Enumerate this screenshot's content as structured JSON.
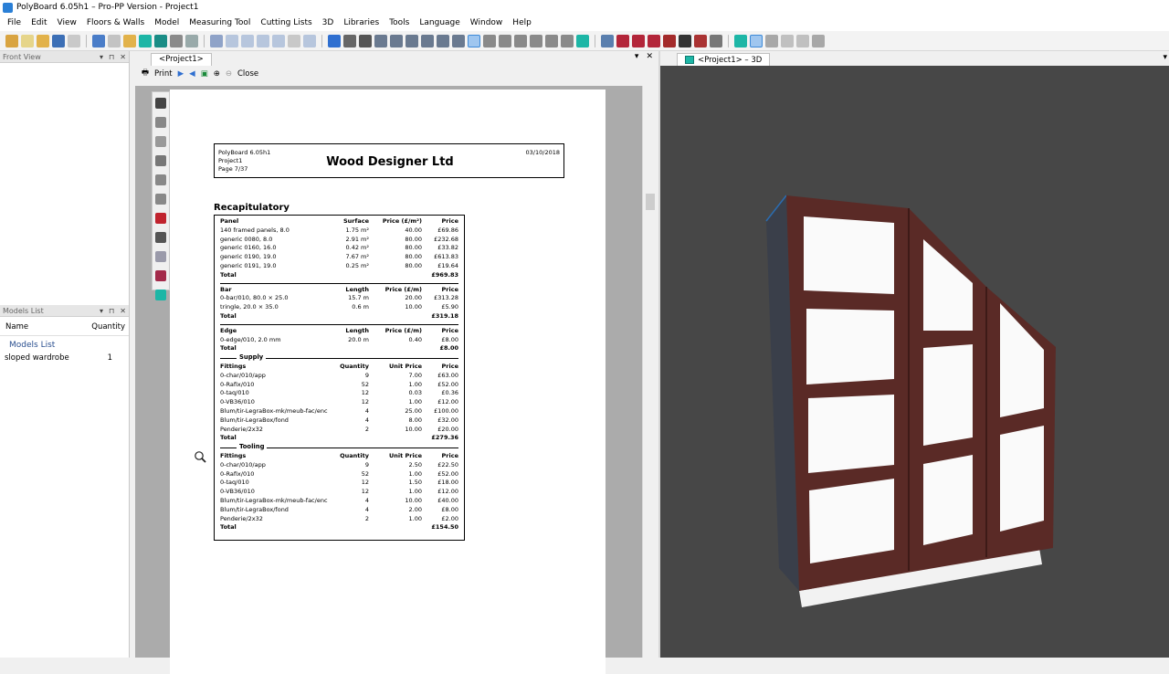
{
  "window": {
    "title": "PolyBoard 6.05h1 – Pro-PP Version - Project1"
  },
  "menu": [
    "File",
    "Edit",
    "View",
    "Floors & Walls",
    "Model",
    "Measuring Tool",
    "Cutting Lists",
    "3D",
    "Libraries",
    "Tools",
    "Language",
    "Window",
    "Help"
  ],
  "left_panel": {
    "front_view": {
      "title": "Front View"
    },
    "models_list": {
      "title": "Models List",
      "col_name": "Name",
      "col_quantity": "Quantity",
      "group": "Models List",
      "items": [
        {
          "name": "sloped wardrobe",
          "quantity": "1"
        }
      ]
    }
  },
  "doc_tab": {
    "label": "<Project1>"
  },
  "doc_toolbar": {
    "print": "Print",
    "close": "Close"
  },
  "report": {
    "meta": [
      "PolyBoard 6.05h1",
      "Project1",
      "Page 7/37"
    ],
    "company": "Wood Designer Ltd",
    "date": "03/10/2018",
    "section_title": "Recapitulatory",
    "panel": {
      "headers": [
        "Panel",
        "Surface",
        "Price (£/m²)",
        "Price"
      ],
      "rows": [
        [
          "140 framed panels, 8.0",
          "1.75 m²",
          "40.00",
          "£69.86"
        ],
        [
          "generic 0080, 8.0",
          "2.91 m²",
          "80.00",
          "£232.68"
        ],
        [
          "generic 0160, 16.0",
          "0.42 m²",
          "80.00",
          "£33.82"
        ],
        [
          "generic 0190, 19.0",
          "7.67 m²",
          "80.00",
          "£613.83"
        ],
        [
          "generic 0191, 19.0",
          "0.25 m²",
          "80.00",
          "£19.64"
        ]
      ],
      "total_label": "Total",
      "total": "£969.83"
    },
    "bar": {
      "headers": [
        "Bar",
        "Length",
        "Price (£/m)",
        "Price"
      ],
      "rows": [
        [
          "0-bar/010, 80.0 × 25.0",
          "15.7 m",
          "20.00",
          "£313.28"
        ],
        [
          "tringle, 20.0 × 35.0",
          "0.6 m",
          "10.00",
          "£5.90"
        ]
      ],
      "total_label": "Total",
      "total": "£319.18"
    },
    "edge": {
      "headers": [
        "Edge",
        "Length",
        "Price (£/m)",
        "Price"
      ],
      "rows": [
        [
          "0-edge/010, 2.0 mm",
          "20.0 m",
          "0.40",
          "£8.00"
        ]
      ],
      "total_label": "Total",
      "total": "£8.00"
    },
    "supply": {
      "title": "Supply",
      "headers": [
        "Fittings",
        "Quantity",
        "Unit Price",
        "Price"
      ],
      "rows": [
        [
          "0-char/010/app",
          "9",
          "7.00",
          "£63.00"
        ],
        [
          "0-Rafix/010",
          "52",
          "1.00",
          "£52.00"
        ],
        [
          "0-taq/010",
          "12",
          "0.03",
          "£0.36"
        ],
        [
          "0-VB36/010",
          "12",
          "1.00",
          "£12.00"
        ],
        [
          "Blum/tir-LegraBox-mk/meub-fac/enc",
          "4",
          "25.00",
          "£100.00"
        ],
        [
          "Blum/tir-LegraBox/fond",
          "4",
          "8.00",
          "£32.00"
        ],
        [
          "Penderie/2x32",
          "2",
          "10.00",
          "£20.00"
        ]
      ],
      "total_label": "Total",
      "total": "£279.36"
    },
    "tooling": {
      "title": "Tooling",
      "headers": [
        "Fittings",
        "Quantity",
        "Unit Price",
        "Price"
      ],
      "rows": [
        [
          "0-char/010/app",
          "9",
          "2.50",
          "£22.50"
        ],
        [
          "0-Rafix/010",
          "52",
          "1.00",
          "£52.00"
        ],
        [
          "0-taq/010",
          "12",
          "1.50",
          "£18.00"
        ],
        [
          "0-VB36/010",
          "12",
          "1.00",
          "£12.00"
        ],
        [
          "Blum/tir-LegraBox-mk/meub-fac/enc",
          "4",
          "10.00",
          "£40.00"
        ],
        [
          "Blum/tir-LegraBox/fond",
          "4",
          "2.00",
          "£8.00"
        ],
        [
          "Penderie/2x32",
          "2",
          "1.00",
          "£2.00"
        ]
      ],
      "total_label": "Total",
      "total": "£154.50"
    }
  },
  "view3d_tab": {
    "label": "<Project1> – 3D"
  },
  "colors": {
    "wood": "#5a2a26",
    "panel": "#ffffff",
    "background3d": "#474747",
    "accent_cube": "#1db6a6"
  }
}
